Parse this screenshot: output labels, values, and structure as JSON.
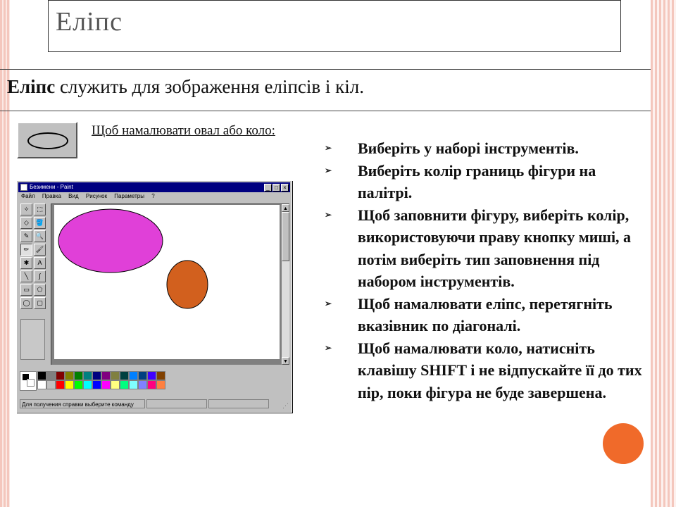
{
  "slide": {
    "title": "Еліпс",
    "subtitle_bold": "Еліпс",
    "subtitle_rest": " служить для зображення еліпсів і кіл.",
    "howto_heading": "Щоб намалювати овал або коло:",
    "instructions": [
      "Виберіть у наборі інструментів.",
      "Виберіть колір границь фігури на палітрі.",
      "Щоб заповнити фігуру, виберіть колір, використовуючи праву кнопку миші, а потім виберіть тип заповнення під набором інструментів.",
      "Щоб намалювати еліпс, перетягніть вказівник по діагоналі.",
      "Щоб намалювати коло, натисніть клавішу SHIFT і не відпускайте її до тих пір, поки фігура не буде завершена."
    ]
  },
  "paint": {
    "window_title": "Безимени - Paint",
    "menu": [
      "Файл",
      "Правка",
      "Вид",
      "Рисунок",
      "Параметры",
      "?"
    ],
    "title_buttons": [
      "_",
      "□",
      "×"
    ],
    "tools": [
      "✧",
      "⬚",
      "◇",
      "🪣",
      "✎",
      "🔍",
      "✏",
      "🖌",
      "✱",
      "A",
      "╲",
      "∫",
      "▭",
      "⬠",
      "◯",
      "▢"
    ],
    "status_text": "Для получения справки выберите команду",
    "palette_colors": [
      "#000000",
      "#808080",
      "#800000",
      "#808000",
      "#008000",
      "#008080",
      "#000080",
      "#800080",
      "#808040",
      "#004040",
      "#0080ff",
      "#004080",
      "#4000ff",
      "#804000",
      "#ffffff",
      "#c0c0c0",
      "#ff0000",
      "#ffff00",
      "#00ff00",
      "#00ffff",
      "#0000ff",
      "#ff00ff",
      "#ffff80",
      "#00ff80",
      "#80ffff",
      "#8080ff",
      "#ff0080",
      "#ff8040"
    ],
    "shape_colors": {
      "ellipse": "#e040d8",
      "circle": "#d2601e"
    }
  },
  "colors": {
    "accent": "#f06a2a",
    "stripe": "#f4c7bd"
  }
}
